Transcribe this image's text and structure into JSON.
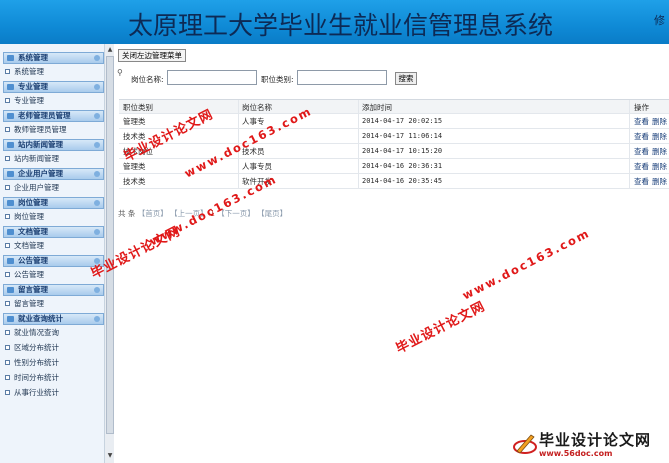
{
  "header": {
    "title": "太原理工大学毕业生就业信管理息系统",
    "corner": "修"
  },
  "sidebar": {
    "groups": [
      {
        "title": "系统管理",
        "items": [
          "系统管理"
        ]
      },
      {
        "title": "专业管理",
        "items": [
          "专业管理"
        ]
      },
      {
        "title": "老师管理员管理",
        "items": [
          "教师管理员管理"
        ]
      },
      {
        "title": "站内新闻管理",
        "items": [
          "站内新闻管理"
        ]
      },
      {
        "title": "企业用户管理",
        "items": [
          "企业用户管理"
        ]
      },
      {
        "title": "岗位管理",
        "items": [
          "岗位管理"
        ]
      },
      {
        "title": "文档管理",
        "items": [
          "文档管理"
        ]
      },
      {
        "title": "公告管理",
        "items": [
          "公告管理"
        ]
      },
      {
        "title": "留言管理",
        "items": [
          "留言管理"
        ]
      },
      {
        "title": "就业查询统计",
        "items": [
          "就业情况查询",
          "区域分布统计",
          "性别分布统计",
          "时间分布统计",
          "从事行业统计"
        ]
      }
    ]
  },
  "toolbar": {
    "toggle_label": "关闭左边管理菜单"
  },
  "search": {
    "name_label": "岗位名称:",
    "type_label": "职位类别:",
    "button_label": "搜索",
    "name_value": "",
    "type_value": ""
  },
  "table": {
    "headers": [
      "职位类别",
      "岗位名称",
      "添加时间",
      "操作"
    ],
    "rows": [
      [
        "管理类",
        "人事专",
        "2014-04-17 20:02:15"
      ],
      [
        "技术类",
        "",
        "2014-04-17 11:06:14"
      ],
      [
        "技术岗位",
        "技术员",
        "2014-04-17 10:15:20"
      ],
      [
        "管理类",
        "人事专员",
        "2014-04-16 20:36:31"
      ],
      [
        "技术类",
        "软件开发",
        "2014-04-16 20:35:45"
      ]
    ],
    "actions": [
      "查看",
      "删除"
    ]
  },
  "pager": {
    "prefix": "共",
    "count_label": "条",
    "current": "1",
    "first": "【首页】",
    "prev": "【上一页】",
    "next": "【下一页】",
    "last": "【尾页】"
  },
  "watermarks": {
    "cn": "毕业设计论文网",
    "url": "www.doc163.com"
  },
  "logo": {
    "text": "毕业设计论文网",
    "url": "www.56doc.com"
  },
  "colors": {
    "header_blue": "#0f8ad6",
    "title_navy": "#0d2a55",
    "watermark_red": "#e01818"
  }
}
